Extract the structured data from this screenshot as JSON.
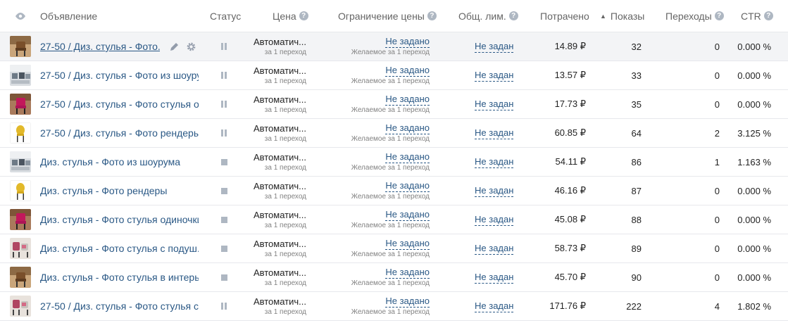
{
  "header": {
    "ad": "Объявление",
    "status": "Статус",
    "price": "Цена",
    "price_limit": "Ограничение цены",
    "total_limit": "Общ. лим.",
    "spent": "Потрачено",
    "impressions": "Показы",
    "clicks": "Переходы",
    "ctr": "CTR",
    "help_glyph": "?"
  },
  "price_sub": "за 1 переход",
  "limit_sub": "Желаемое за 1 переход",
  "rows": [
    {
      "thumb": "brown-chair",
      "name": "27-50 / Диз. стулья - Фото...",
      "status": "paused",
      "price": "Автоматич...",
      "limit": "Не задано",
      "total": "Не задан",
      "spent": "14.89 ₽",
      "impressions": "32",
      "clicks": "0",
      "ctr": "0.000 %"
    },
    {
      "thumb": "showroom",
      "name": "27-50 / Диз. стулья - Фото из шоуру...",
      "status": "paused",
      "price": "Автоматич...",
      "limit": "Не задано",
      "total": "Не задан",
      "spent": "13.57 ₽",
      "impressions": "33",
      "clicks": "0",
      "ctr": "0.000 %"
    },
    {
      "thumb": "pink-chair",
      "name": "27-50 / Диз. стулья - Фото стулья о...",
      "status": "paused",
      "price": "Автоматич...",
      "limit": "Не задано",
      "total": "Не задан",
      "spent": "17.73 ₽",
      "impressions": "35",
      "clicks": "0",
      "ctr": "0.000 %"
    },
    {
      "thumb": "yellow-chair",
      "name": "27-50 / Диз. стулья - Фото рендеры",
      "status": "paused",
      "price": "Автоматич...",
      "limit": "Не задано",
      "total": "Не задан",
      "spent": "60.85 ₽",
      "impressions": "64",
      "clicks": "2",
      "ctr": "3.125 %"
    },
    {
      "thumb": "showroom",
      "name": "Диз. стулья - Фото из шоурума",
      "status": "stopped",
      "price": "Автоматич...",
      "limit": "Не задано",
      "total": "Не задан",
      "spent": "54.11 ₽",
      "impressions": "86",
      "clicks": "1",
      "ctr": "1.163 %"
    },
    {
      "thumb": "yellow-chair",
      "name": "Диз. стулья - Фото рендеры",
      "status": "stopped",
      "price": "Автоматич...",
      "limit": "Не задано",
      "total": "Не задан",
      "spent": "46.16 ₽",
      "impressions": "87",
      "clicks": "0",
      "ctr": "0.000 %"
    },
    {
      "thumb": "pink-chair",
      "name": "Диз. стулья - Фото стулья одиночки",
      "status": "stopped",
      "price": "Автоматич...",
      "limit": "Не задано",
      "total": "Не задан",
      "spent": "45.08 ₽",
      "impressions": "88",
      "clicks": "0",
      "ctr": "0.000 %"
    },
    {
      "thumb": "pink-pillow-chair",
      "name": "Диз. стулья - Фото стулья с подуш...",
      "status": "stopped",
      "price": "Автоматич...",
      "limit": "Не задано",
      "total": "Не задан",
      "spent": "58.73 ₽",
      "impressions": "89",
      "clicks": "0",
      "ctr": "0.000 %"
    },
    {
      "thumb": "brown-chair",
      "name": "Диз. стулья - Фото стулья в интерь...",
      "status": "stopped",
      "price": "Автоматич...",
      "limit": "Не задано",
      "total": "Не задан",
      "spent": "45.70 ₽",
      "impressions": "90",
      "clicks": "0",
      "ctr": "0.000 %"
    },
    {
      "thumb": "pink-pillow-chair",
      "name": "27-50 / Диз. стулья - Фото стулья с ...",
      "status": "paused",
      "price": "Автоматич...",
      "limit": "Не задано",
      "total": "Не задан",
      "spent": "171.76 ₽",
      "impressions": "222",
      "clicks": "4",
      "ctr": "1.802 %"
    }
  ]
}
